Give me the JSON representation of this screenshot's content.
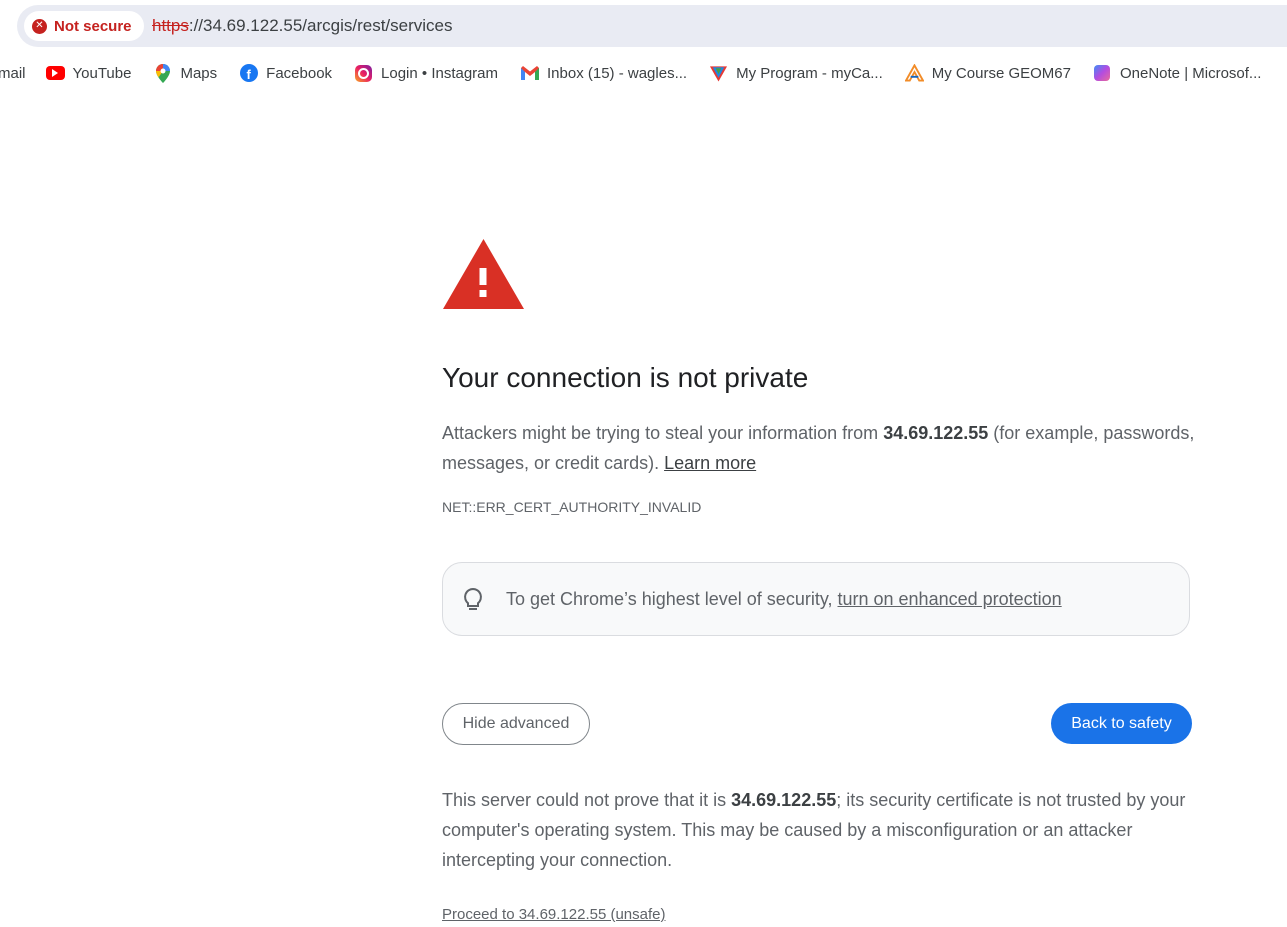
{
  "address_bar": {
    "security_label": "Not secure",
    "url_scheme": "https",
    "url_rest": "://34.69.122.55/arcgis/rest/services"
  },
  "bookmarks": [
    {
      "label": "mail",
      "icon": "gmail-icon"
    },
    {
      "label": "YouTube",
      "icon": "youtube-icon"
    },
    {
      "label": "Maps",
      "icon": "maps-pin-icon"
    },
    {
      "label": "Facebook",
      "icon": "facebook-icon"
    },
    {
      "label": "Login • Instagram",
      "icon": "instagram-icon"
    },
    {
      "label": "Inbox (15) - wagles...",
      "icon": "gmail-icon"
    },
    {
      "label": "My Program - myCa...",
      "icon": "mycampus-icon"
    },
    {
      "label": "My Course GEOM67",
      "icon": "course-icon"
    },
    {
      "label": "OneNote | Microsof...",
      "icon": "onenote-icon"
    }
  ],
  "interstitial": {
    "heading": "Your connection is not private",
    "explain_prefix": "Attackers might be trying to steal your information from ",
    "host": "34.69.122.55",
    "explain_suffix": " (for example, passwords, messages, or credit cards). ",
    "learn_more": "Learn more",
    "error_code": "NET::ERR_CERT_AUTHORITY_INVALID",
    "enhanced_text": "To get Chrome’s highest level of security, ",
    "enhanced_link": "turn on enhanced protection",
    "hide_advanced": "Hide advanced",
    "back_to_safety": "Back to safety",
    "details_prefix": "This server could not prove that it is ",
    "details_suffix": "; its security certificate is not trusted by your computer's operating system. This may be caused by a misconfiguration or an attacker intercepting your connection.",
    "proceed_link": "Proceed to 34.69.122.55 (unsafe)"
  },
  "colors": {
    "danger": "#c5221f",
    "warning_triangle": "#d93025",
    "primary_button": "#1a73e8",
    "omnibox_bg": "#e9ebf3"
  }
}
